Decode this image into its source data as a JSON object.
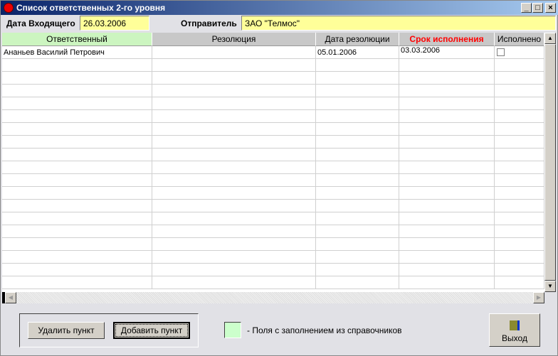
{
  "window": {
    "title": "Список ответственных 2-го уровня",
    "minimize": "_",
    "maximize": "□",
    "close": "×"
  },
  "form": {
    "incoming_date_label": "Дата Входящего",
    "incoming_date": "26.03.2006",
    "sender_label": "Отправитель",
    "sender": "ЗАО \"Телмос\""
  },
  "table": {
    "columns": [
      "Ответственный",
      "Резолюция",
      "Дата резолюции",
      "Срок исполнения",
      "Исполнено"
    ],
    "rows": [
      {
        "responsible": "Ананьев Василий Петрович",
        "resolution": "",
        "resolution_date": "05.01.2006",
        "deadline": "03.03.2006",
        "done": false
      }
    ]
  },
  "colors": {
    "lookup_field": "#ccffcc",
    "deadline_header": "#ff0000",
    "input_bg": "#ffff99"
  },
  "footer": {
    "delete_label": "Удалить пункт",
    "add_label": "Добавить пункт",
    "legend_text": "-  Поля с заполнением из справочников",
    "exit_label": "Выход"
  }
}
